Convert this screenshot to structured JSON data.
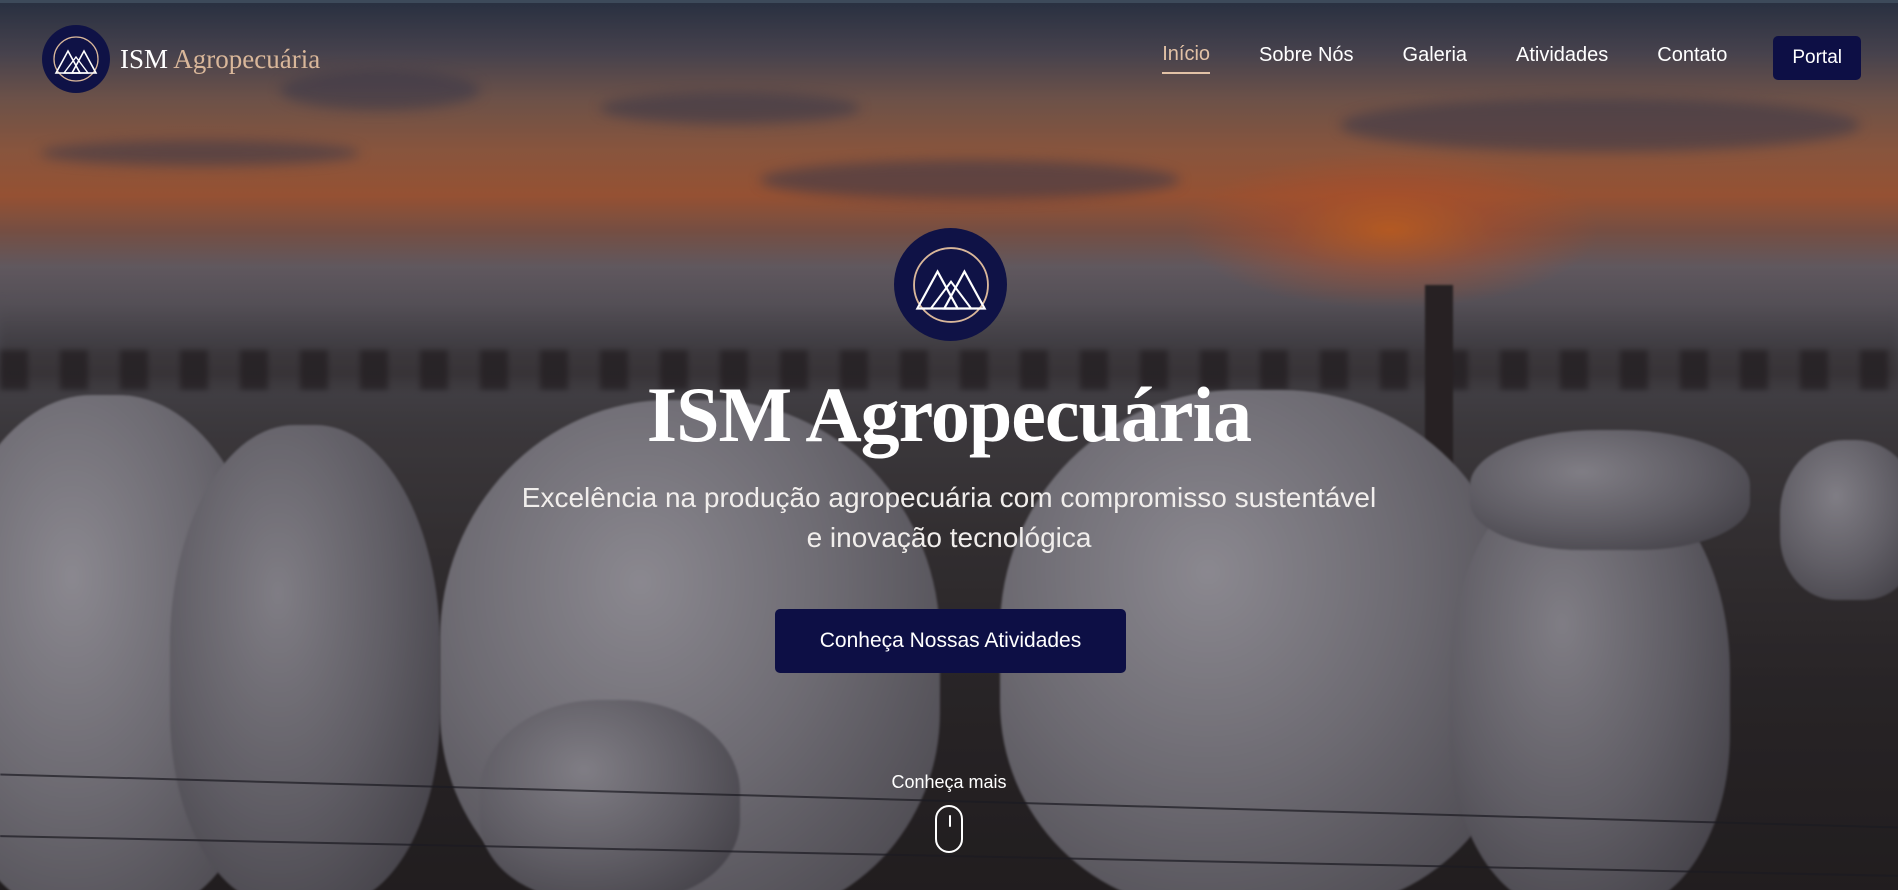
{
  "brand": {
    "name_part1": "ISM",
    "name_part2": "Agropecuária",
    "logo_icon": "mountain-triangles-logo"
  },
  "nav": {
    "items": [
      {
        "label": "Início",
        "active": true
      },
      {
        "label": "Sobre Nós",
        "active": false
      },
      {
        "label": "Galeria",
        "active": false
      },
      {
        "label": "Atividades",
        "active": false
      },
      {
        "label": "Contato",
        "active": false
      }
    ],
    "portal_label": "Portal"
  },
  "hero": {
    "title": "ISM Agropecuária",
    "subtitle_line1": "Excelência na produção agropecuária com compromisso sustentável",
    "subtitle_line2": "e inovação tecnológica",
    "cta_label": "Conheça Nossas Atividades",
    "scroll_label": "Conheça mais",
    "scroll_icon": "mouse-scroll-icon"
  },
  "colors": {
    "navy": "#0d0f45",
    "accent": "#e2c2a6",
    "text": "#ffffff"
  }
}
